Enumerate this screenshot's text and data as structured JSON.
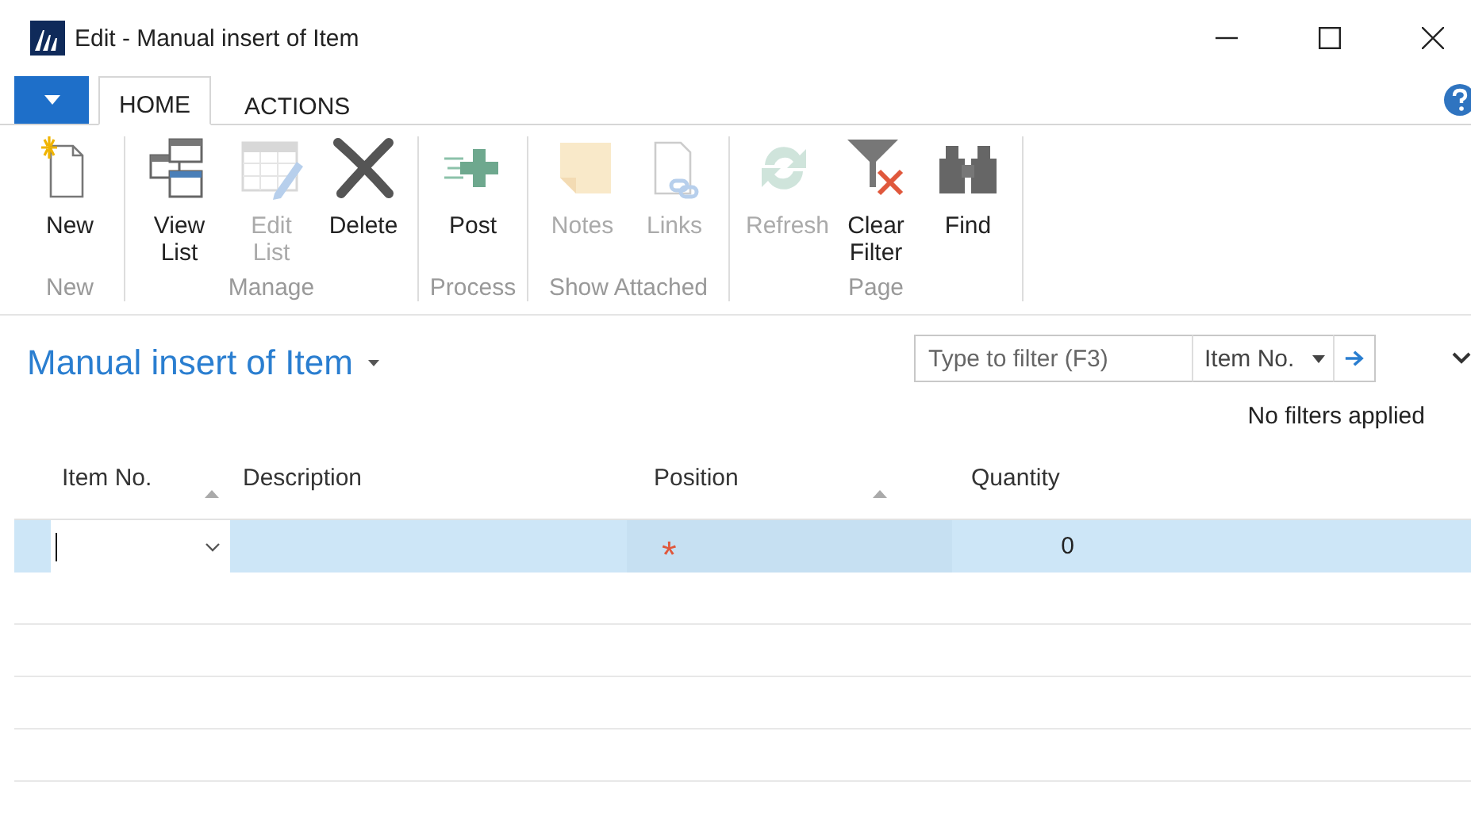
{
  "window": {
    "title": "Edit - Manual insert of Item"
  },
  "tabs": [
    {
      "label": "HOME",
      "selected": true
    },
    {
      "label": "ACTIONS",
      "selected": false
    }
  ],
  "ribbon": [
    {
      "label": "New",
      "buttons": [
        {
          "label": "New",
          "disabled": false
        }
      ]
    },
    {
      "label": "Manage",
      "buttons": [
        {
          "label": "View List",
          "disabled": false
        },
        {
          "label": "Edit List",
          "disabled": true
        },
        {
          "label": "Delete",
          "disabled": false
        }
      ]
    },
    {
      "label": "Process",
      "buttons": [
        {
          "label": "Post",
          "disabled": false
        }
      ]
    },
    {
      "label": "Show Attached",
      "buttons": [
        {
          "label": "Notes",
          "disabled": true
        },
        {
          "label": "Links",
          "disabled": true
        }
      ]
    },
    {
      "label": "Page",
      "buttons": [
        {
          "label": "Refresh",
          "disabled": true
        },
        {
          "label": "Clear Filter",
          "disabled": false
        },
        {
          "label": "Find",
          "disabled": false
        }
      ]
    }
  ],
  "page_title": "Manual insert of Item",
  "filter": {
    "placeholder": "Type to filter (F3)",
    "field": "Item No.",
    "status": "No filters applied"
  },
  "table": {
    "columns": [
      {
        "label": "Item No.",
        "sort_arrow": true
      },
      {
        "label": "Description",
        "sort_arrow": false
      },
      {
        "label": "Position",
        "sort_arrow": true
      },
      {
        "label": "Quantity",
        "sort_arrow": false
      }
    ],
    "rows": [
      {
        "selected": true,
        "cells": [
          "",
          "",
          "*",
          "0"
        ]
      }
    ]
  }
}
